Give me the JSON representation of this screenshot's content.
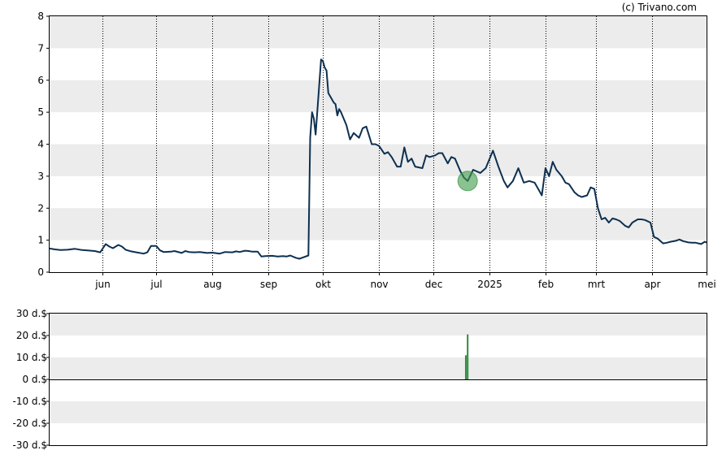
{
  "credit": "(c) Trivano.com",
  "colors": {
    "price_line": "#0d3050",
    "band": "#ececec",
    "marker_fill": "#3d9a4a",
    "volume_bar": "#2e8b3e",
    "axis": "#000000"
  },
  "chart_data": [
    {
      "type": "line",
      "title": "",
      "xlabel": "",
      "ylabel": "",
      "ylim": [
        0,
        8
      ],
      "yticks": [
        "0",
        "1",
        "2",
        "3",
        "4",
        "5",
        "6",
        "7",
        "8"
      ],
      "grid": "alternating horizontal bands, dotted vertical lines at month starts",
      "x_start": "2024-05-03",
      "x_end": "2025-05-01",
      "xticks": [
        {
          "label": "jun",
          "date": "2024-06-01"
        },
        {
          "label": "jul",
          "date": "2024-07-01"
        },
        {
          "label": "aug",
          "date": "2024-08-01"
        },
        {
          "label": "sep",
          "date": "2024-09-01"
        },
        {
          "label": "okt",
          "date": "2024-10-01"
        },
        {
          "label": "nov",
          "date": "2024-11-01"
        },
        {
          "label": "dec",
          "date": "2024-12-01"
        },
        {
          "label": "2025",
          "date": "2025-01-01"
        },
        {
          "label": "feb",
          "date": "2025-02-01"
        },
        {
          "label": "mrt",
          "date": "2025-03-01"
        },
        {
          "label": "apr",
          "date": "2025-04-01"
        },
        {
          "label": "mei",
          "date": "2025-05-01"
        }
      ],
      "series": [
        {
          "points": [
            [
              "2024-05-03",
              0.74
            ],
            [
              "2024-05-06",
              0.71
            ],
            [
              "2024-05-09",
              0.69
            ],
            [
              "2024-05-13",
              0.7
            ],
            [
              "2024-05-17",
              0.73
            ],
            [
              "2024-05-21",
              0.69
            ],
            [
              "2024-05-24",
              0.68
            ],
            [
              "2024-05-28",
              0.66
            ],
            [
              "2024-05-31",
              0.62
            ],
            [
              "2024-06-03",
              0.88
            ],
            [
              "2024-06-05",
              0.8
            ],
            [
              "2024-06-07",
              0.75
            ],
            [
              "2024-06-10",
              0.85
            ],
            [
              "2024-06-12",
              0.8
            ],
            [
              "2024-06-14",
              0.7
            ],
            [
              "2024-06-17",
              0.65
            ],
            [
              "2024-06-20",
              0.62
            ],
            [
              "2024-06-24",
              0.58
            ],
            [
              "2024-06-26",
              0.62
            ],
            [
              "2024-06-28",
              0.82
            ],
            [
              "2024-07-01",
              0.82
            ],
            [
              "2024-07-03",
              0.68
            ],
            [
              "2024-07-05",
              0.63
            ],
            [
              "2024-07-09",
              0.64
            ],
            [
              "2024-07-11",
              0.66
            ],
            [
              "2024-07-15",
              0.6
            ],
            [
              "2024-07-17",
              0.66
            ],
            [
              "2024-07-19",
              0.63
            ],
            [
              "2024-07-22",
              0.62
            ],
            [
              "2024-07-25",
              0.63
            ],
            [
              "2024-07-29",
              0.6
            ],
            [
              "2024-08-01",
              0.61
            ],
            [
              "2024-08-05",
              0.58
            ],
            [
              "2024-08-08",
              0.63
            ],
            [
              "2024-08-12",
              0.62
            ],
            [
              "2024-08-14",
              0.65
            ],
            [
              "2024-08-16",
              0.63
            ],
            [
              "2024-08-19",
              0.67
            ],
            [
              "2024-08-21",
              0.66
            ],
            [
              "2024-08-23",
              0.64
            ],
            [
              "2024-08-26",
              0.64
            ],
            [
              "2024-08-28",
              0.49
            ],
            [
              "2024-08-30",
              0.5
            ],
            [
              "2024-09-03",
              0.51
            ],
            [
              "2024-09-06",
              0.49
            ],
            [
              "2024-09-09",
              0.5
            ],
            [
              "2024-09-11",
              0.49
            ],
            [
              "2024-09-13",
              0.52
            ],
            [
              "2024-09-16",
              0.45
            ],
            [
              "2024-09-18",
              0.42
            ],
            [
              "2024-09-20",
              0.46
            ],
            [
              "2024-09-23",
              0.52
            ],
            [
              "2024-09-24",
              4.2
            ],
            [
              "2024-09-25",
              5.0
            ],
            [
              "2024-09-26",
              4.8
            ],
            [
              "2024-09-27",
              4.3
            ],
            [
              "2024-09-30",
              6.65
            ],
            [
              "2024-10-01",
              6.6
            ],
            [
              "2024-10-02",
              6.4
            ],
            [
              "2024-10-03",
              6.3
            ],
            [
              "2024-10-04",
              5.6
            ],
            [
              "2024-10-07",
              5.3
            ],
            [
              "2024-10-08",
              5.25
            ],
            [
              "2024-10-09",
              4.9
            ],
            [
              "2024-10-10",
              5.1
            ],
            [
              "2024-10-11",
              5.0
            ],
            [
              "2024-10-14",
              4.6
            ],
            [
              "2024-10-16",
              4.15
            ],
            [
              "2024-10-18",
              4.35
            ],
            [
              "2024-10-21",
              4.2
            ],
            [
              "2024-10-23",
              4.5
            ],
            [
              "2024-10-25",
              4.55
            ],
            [
              "2024-10-28",
              4.0
            ],
            [
              "2024-10-30",
              4.0
            ],
            [
              "2024-11-01",
              3.95
            ],
            [
              "2024-11-04",
              3.7
            ],
            [
              "2024-11-06",
              3.75
            ],
            [
              "2024-11-08",
              3.6
            ],
            [
              "2024-11-11",
              3.3
            ],
            [
              "2024-11-13",
              3.3
            ],
            [
              "2024-11-15",
              3.9
            ],
            [
              "2024-11-17",
              3.45
            ],
            [
              "2024-11-19",
              3.55
            ],
            [
              "2024-11-21",
              3.3
            ],
            [
              "2024-11-25",
              3.25
            ],
            [
              "2024-11-27",
              3.65
            ],
            [
              "2024-11-29",
              3.6
            ],
            [
              "2024-12-02",
              3.65
            ],
            [
              "2024-12-04",
              3.72
            ],
            [
              "2024-12-06",
              3.72
            ],
            [
              "2024-12-09",
              3.4
            ],
            [
              "2024-12-11",
              3.6
            ],
            [
              "2024-12-13",
              3.55
            ],
            [
              "2024-12-16",
              3.15
            ],
            [
              "2024-12-18",
              2.95
            ],
            [
              "2024-12-20",
              2.85
            ],
            [
              "2024-12-23",
              3.2
            ],
            [
              "2024-12-27",
              3.1
            ],
            [
              "2024-12-30",
              3.25
            ],
            [
              "2025-01-03",
              3.8
            ],
            [
              "2025-01-06",
              3.3
            ],
            [
              "2025-01-09",
              2.85
            ],
            [
              "2025-01-11",
              2.65
            ],
            [
              "2025-01-14",
              2.85
            ],
            [
              "2025-01-17",
              3.25
            ],
            [
              "2025-01-20",
              2.8
            ],
            [
              "2025-01-23",
              2.85
            ],
            [
              "2025-01-26",
              2.8
            ],
            [
              "2025-01-28",
              2.6
            ],
            [
              "2025-01-30",
              2.4
            ],
            [
              "2025-02-01",
              3.25
            ],
            [
              "2025-02-03",
              3.0
            ],
            [
              "2025-02-05",
              3.45
            ],
            [
              "2025-02-07",
              3.2
            ],
            [
              "2025-02-10",
              3.0
            ],
            [
              "2025-02-12",
              2.8
            ],
            [
              "2025-02-14",
              2.75
            ],
            [
              "2025-02-17",
              2.5
            ],
            [
              "2025-02-19",
              2.4
            ],
            [
              "2025-02-21",
              2.35
            ],
            [
              "2025-02-24",
              2.4
            ],
            [
              "2025-02-26",
              2.65
            ],
            [
              "2025-02-28",
              2.6
            ],
            [
              "2025-03-02",
              2.0
            ],
            [
              "2025-03-04",
              1.65
            ],
            [
              "2025-03-06",
              1.7
            ],
            [
              "2025-03-08",
              1.55
            ],
            [
              "2025-03-10",
              1.68
            ],
            [
              "2025-03-12",
              1.65
            ],
            [
              "2025-03-14",
              1.6
            ],
            [
              "2025-03-17",
              1.45
            ],
            [
              "2025-03-19",
              1.4
            ],
            [
              "2025-03-21",
              1.55
            ],
            [
              "2025-03-24",
              1.65
            ],
            [
              "2025-03-26",
              1.65
            ],
            [
              "2025-03-28",
              1.63
            ],
            [
              "2025-03-31",
              1.55
            ],
            [
              "2025-04-02",
              1.1
            ],
            [
              "2025-04-04",
              1.05
            ],
            [
              "2025-04-07",
              0.9
            ],
            [
              "2025-04-09",
              0.92
            ],
            [
              "2025-04-11",
              0.95
            ],
            [
              "2025-04-14",
              0.98
            ],
            [
              "2025-04-16",
              1.02
            ],
            [
              "2025-04-18",
              0.97
            ],
            [
              "2025-04-21",
              0.93
            ],
            [
              "2025-04-23",
              0.92
            ],
            [
              "2025-04-25",
              0.92
            ],
            [
              "2025-04-28",
              0.88
            ],
            [
              "2025-04-30",
              0.95
            ],
            [
              "2025-05-01",
              0.93
            ]
          ]
        }
      ],
      "annotations": [
        {
          "type": "circle-marker",
          "date": "2024-12-20",
          "value": 2.85
        }
      ]
    },
    {
      "type": "bar",
      "title": "",
      "ylabel": "",
      "ylim": [
        -30,
        30
      ],
      "yticks": [
        "30 d.$",
        "20 d.$",
        "10 d.$",
        "0 d.$",
        "-10 d.$",
        "-20 d.$",
        "-30 d.$"
      ],
      "grid": "alternating horizontal bands",
      "bars": [
        {
          "date": "2024-12-19",
          "value": 11
        },
        {
          "date": "2024-12-20",
          "value": 20.5
        }
      ]
    }
  ]
}
